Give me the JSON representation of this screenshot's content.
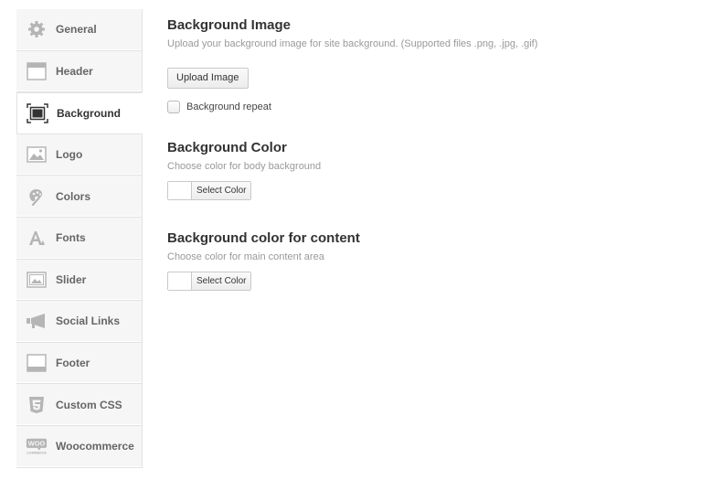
{
  "sidebar": {
    "items": [
      {
        "label": "General",
        "icon": "gear-icon"
      },
      {
        "label": "Header",
        "icon": "header-icon"
      },
      {
        "label": "Background",
        "icon": "background-icon",
        "active": true
      },
      {
        "label": "Logo",
        "icon": "image-icon"
      },
      {
        "label": "Colors",
        "icon": "palette-icon"
      },
      {
        "label": "Fonts",
        "icon": "font-icon"
      },
      {
        "label": "Slider",
        "icon": "slider-icon"
      },
      {
        "label": "Social Links",
        "icon": "megaphone-icon"
      },
      {
        "label": "Footer",
        "icon": "footer-icon"
      },
      {
        "label": "Custom CSS",
        "icon": "css3-icon"
      },
      {
        "label": "Woocommerce",
        "icon": "woocommerce-icon"
      }
    ]
  },
  "background_image": {
    "title": "Background Image",
    "description": "Upload your background image for site background. (Supported files .png, .jpg, .gif)",
    "upload_label": "Upload Image",
    "repeat_label": "Background repeat",
    "repeat_checked": false
  },
  "background_color": {
    "title": "Background Color",
    "description": "Choose color for body background",
    "select_label": "Select Color"
  },
  "content_color": {
    "title": "Background color for content",
    "description": "Choose color for main content area",
    "select_label": "Select Color"
  },
  "woo_logo_text": {
    "top": "WOO",
    "bottom": "COMMERCE"
  }
}
